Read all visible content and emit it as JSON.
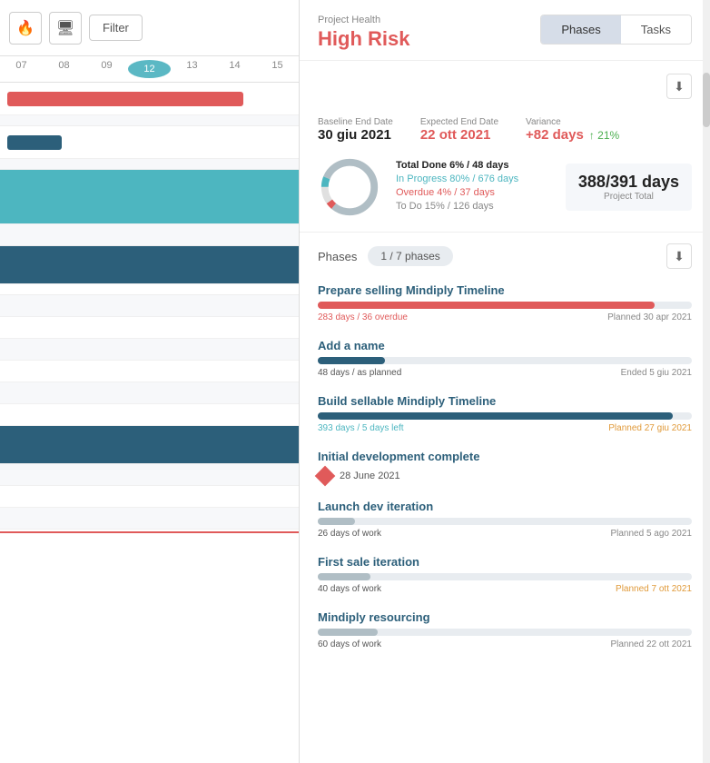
{
  "toolbar": {
    "filter_label": "Filter"
  },
  "timeline": {
    "ticks": [
      "07",
      "08",
      "09",
      "12",
      "13",
      "14",
      "15"
    ]
  },
  "header": {
    "project_health_label": "Project Health",
    "risk_label": "High Risk",
    "tab_phases": "Phases",
    "tab_tasks": "Tasks"
  },
  "stats": {
    "baseline_end_label": "Baseline End Date",
    "baseline_end_val": "30 giu 2021",
    "expected_end_label": "Expected End Date",
    "expected_end_val": "22 ott 2021",
    "variance_label": "Variance",
    "variance_val": "+82 days",
    "variance_pct": "↑ 21%",
    "total_done": "Total Done 6% / 48 days",
    "in_progress": "In Progress 80% / 676 days",
    "overdue": "Overdue 4% / 37 days",
    "to_do": "To Do 15% / 126 days",
    "project_total_days": "388/391 days",
    "project_total_label": "Project Total"
  },
  "donut": {
    "segments": [
      {
        "pct": 6,
        "color": "#4db6c0",
        "offset": 0
      },
      {
        "pct": 80,
        "color": "#b0bec5",
        "offset": 6
      },
      {
        "pct": 4,
        "color": "#e05a5a",
        "offset": 86
      },
      {
        "pct": 10,
        "color": "#e0e0e0",
        "offset": 90
      }
    ]
  },
  "phases": {
    "label": "Phases",
    "badge": "1 / 7 phases",
    "items": [
      {
        "name": "Prepare selling Mindiply Timeline",
        "bar_pct": 90,
        "bar_type": "red",
        "meta_left": "283 days / 36 overdue",
        "meta_right": "Planned 30 apr 2021",
        "meta_left_class": "overdue",
        "meta_right_class": "planned"
      },
      {
        "name": "Add a name",
        "bar_pct": 18,
        "bar_type": "dark",
        "meta_left": "48 days / as planned",
        "meta_right": "Ended 5 giu 2021",
        "meta_left_class": "",
        "meta_right_class": "ended"
      },
      {
        "name": "Build sellable Mindiply Timeline",
        "bar_pct": 95,
        "bar_type": "dark",
        "meta_left": "393 days / 5 days left",
        "meta_right": "Planned 27 giu 2021",
        "meta_left_class": "",
        "meta_right_class": "left-days planned-orange"
      },
      {
        "name": "Initial development complete",
        "is_milestone": true,
        "milestone_date": "28 June 2021"
      },
      {
        "name": "Launch dev iteration",
        "bar_pct": 10,
        "bar_type": "gray",
        "meta_left": "26 days of work",
        "meta_right": "Planned 5 ago 2021",
        "meta_left_class": "",
        "meta_right_class": "planned"
      },
      {
        "name": "First sale iteration",
        "bar_pct": 14,
        "bar_type": "gray",
        "meta_left": "40 days of work",
        "meta_right": "Planned 7 ott 2021",
        "meta_left_class": "",
        "meta_right_class": "planned orange"
      },
      {
        "name": "Mindiply resourcing",
        "bar_pct": 16,
        "bar_type": "gray",
        "meta_left": "60 days of work",
        "meta_right": "Planned 22 ott 2021",
        "meta_left_class": "",
        "meta_right_class": "planned"
      }
    ]
  }
}
